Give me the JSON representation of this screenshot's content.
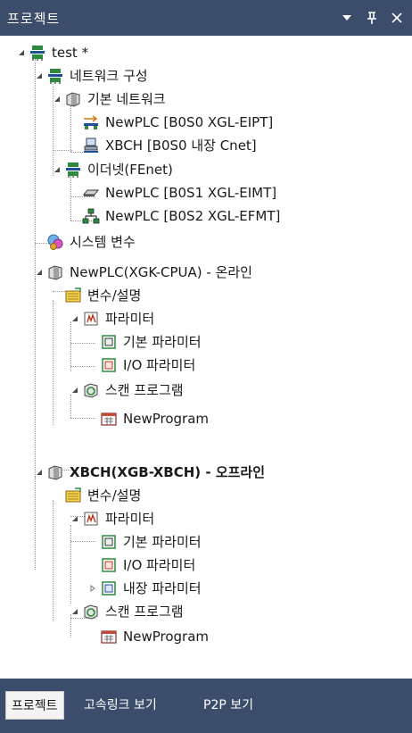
{
  "panel": {
    "title": "프로젝트",
    "buttons": {
      "dropdown": "▾",
      "pin": "ᵽ",
      "close": "×"
    }
  },
  "tree": {
    "root": "test *",
    "network_config": "네트워크 구성",
    "basic_network": "기본 네트워크",
    "newplc_eipt": "NewPLC [B0S0 XGL-EIPT]",
    "xbch_cnet": "XBCH [B0S0 내장 Cnet]",
    "ethernet": "이더넷(FEnet)",
    "newplc_eimt": "NewPLC [B0S1 XGL-EIMT]",
    "newplc_efmt": "NewPLC [B0S2 XGL-EFMT]",
    "system_vars": "시스템 변수",
    "plc1": "NewPLC(XGK-CPUA) - 온라인",
    "plc1_vars": "변수/설명",
    "plc1_params": "파라미터",
    "plc1_basic_param": "기본 파라미터",
    "plc1_io_param": "I/O 파라미터",
    "plc1_scan": "스캔 프로그램",
    "plc1_program": "NewProgram",
    "plc2": "XBCH(XGB-XBCH) - 오프라인",
    "plc2_vars": "변수/설명",
    "plc2_params": "파라미터",
    "plc2_basic_param": "기본 파라미터",
    "plc2_io_param": "I/O 파라미터",
    "plc2_builtin_param": "내장 파라미터",
    "plc2_scan": "스캔 프로그램",
    "plc2_program": "NewProgram"
  },
  "tabs": [
    {
      "label": "프로젝트",
      "active": true
    },
    {
      "label": "고속링크 보기",
      "active": false
    },
    {
      "label": "P2P 보기",
      "active": false
    }
  ],
  "icons": {
    "network": "network-icon",
    "cpu": "cpu-module-icon",
    "link": "link-icon",
    "computer": "computer-icon",
    "ethernet_card": "ethernet-card-icon",
    "topology": "network-topology-icon",
    "system_vars": "system-variables-icon",
    "variables": "variables-icon",
    "parameters": "parameters-icon",
    "parameter_doc": "parameter-document-icon",
    "scan": "scan-program-icon",
    "program": "program-icon"
  },
  "colors": {
    "panel_bg": "#3b4d6b",
    "tree_bg": "#ffffff",
    "active_tab_bg": "#f4f4f4"
  }
}
